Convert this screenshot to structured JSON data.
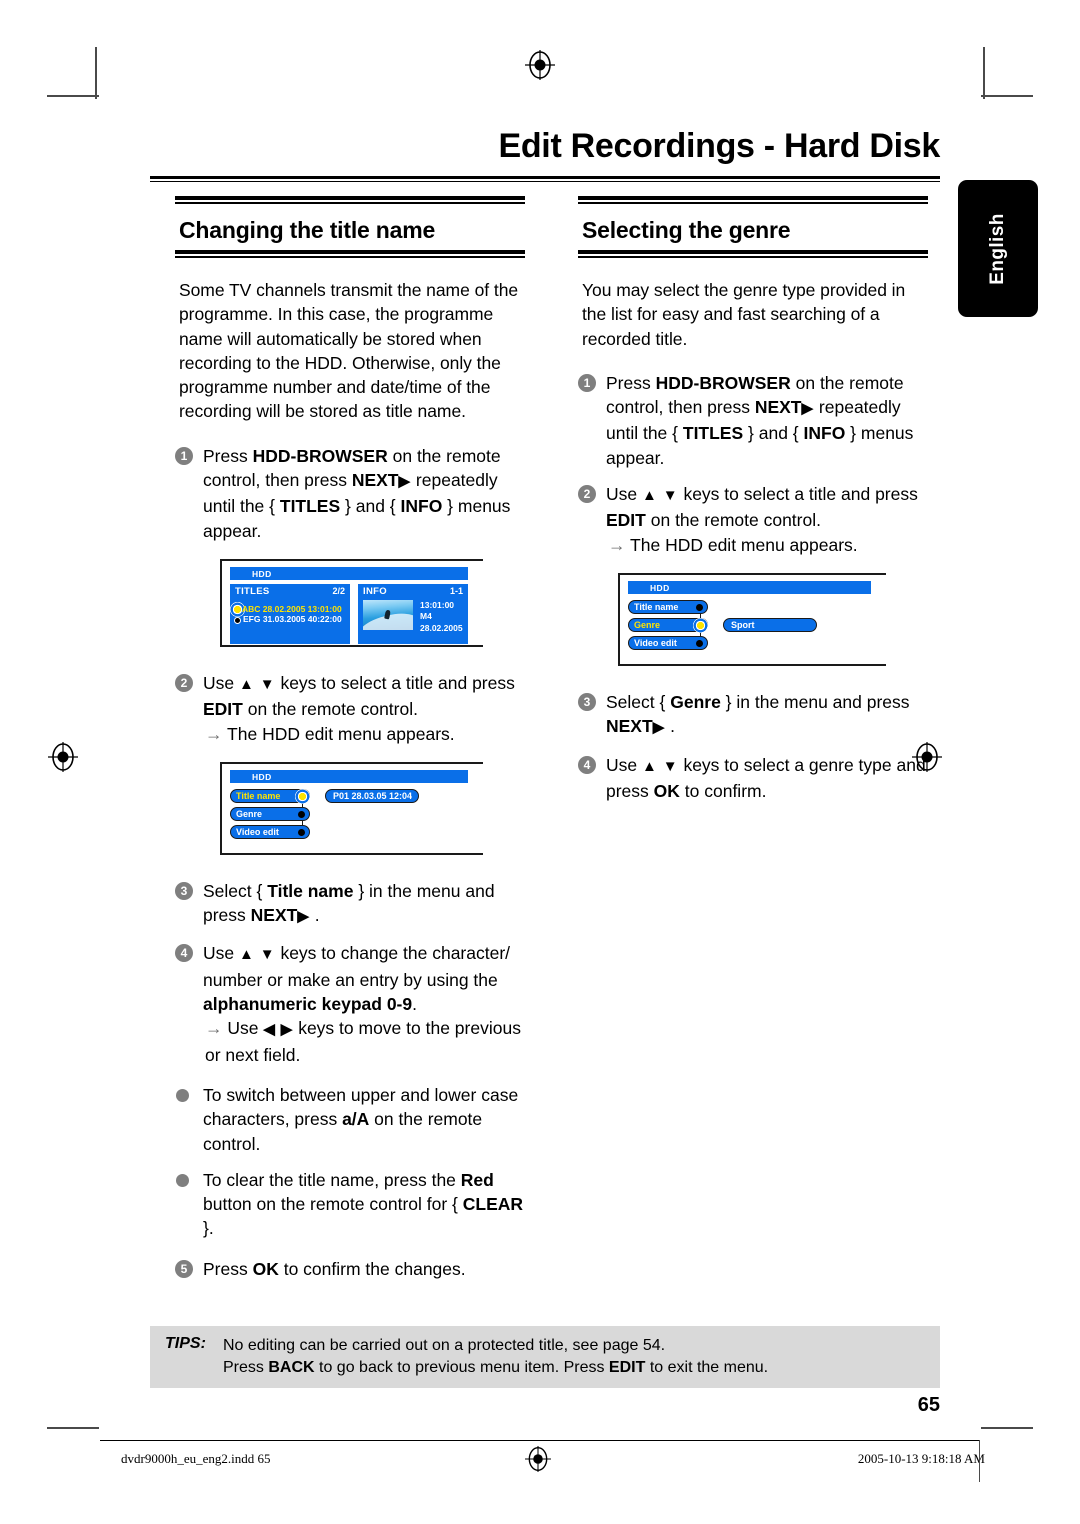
{
  "header": {
    "title": "Edit Recordings - Hard Disk",
    "language_tab": "English"
  },
  "left_column": {
    "heading": "Changing the title name",
    "intro": "Some TV channels transmit the name of the programme. In this case, the programme name will automatically be stored when recording to the HDD. Otherwise, only the programme number and date/time of the recording will be stored as title name.",
    "step1": {
      "num": "1",
      "part1": "Press ",
      "b1": "HDD-BROWSER",
      "part2": " on the remote control, then press ",
      "b2": "NEXT",
      "tri": "▶",
      "part3": " repeatedly until the { ",
      "b3": "TITLES",
      "part4": " } and { ",
      "b4": "INFO",
      "part5": " } menus appear."
    },
    "screenshot1": {
      "hdd_label": "HDD",
      "titles_panel": {
        "title": "TITLES",
        "count": "2/2",
        "rows": [
          {
            "text": "ABC 28.02.2005   13:01:00",
            "selected": true
          },
          {
            "text": "EFG 31.03.2005   40:22:00",
            "selected": false
          }
        ]
      },
      "info_panel": {
        "title": "INFO",
        "count": "1-1",
        "lines": [
          "13:01:00",
          "M4",
          "28.02.2005"
        ]
      }
    },
    "step2": {
      "num": "2",
      "part1": "Use ",
      "up": "▲",
      "down": "▼",
      "part2": " keys to select a title and press ",
      "b1": "EDIT",
      "part3": " on the remote control.",
      "sub_arrow": "→",
      "sub": " The HDD edit menu appears."
    },
    "screenshot2": {
      "hdd_label": "HDD",
      "items": [
        {
          "label": "Title name",
          "selected": true
        },
        {
          "label": "Genre",
          "selected": false
        },
        {
          "label": "Video edit",
          "selected": false
        }
      ],
      "value": "P01 28.03.05 12:04"
    },
    "step3": {
      "num": "3",
      "part1": "Select { ",
      "b1": "Title name",
      "part2": " } in the menu and press ",
      "b2": "NEXT",
      "tri": "▶",
      "part3": " ."
    },
    "step4": {
      "num": "4",
      "part1": "Use ",
      "up": "▲",
      "down": "▼",
      "part2": " keys to change the character/ number or make an entry by using the ",
      "b1": "alphanumeric keypad 0-9",
      "part3": ".",
      "sub_arrow": "→",
      "sub1": " Use ",
      "left": "◀",
      "right": "▶",
      "sub2": " keys to move to the previous or next field."
    },
    "bullet1": {
      "part1": "To switch between upper and lower case characters, press ",
      "b1": "a/A",
      "part2": " on the remote control."
    },
    "bullet2": {
      "part1": "To clear the title name, press the ",
      "b1": "Red",
      "part2": " button on the remote control for { ",
      "b2": "CLEAR",
      "part3": " }."
    },
    "step5": {
      "num": "5",
      "part1": "Press ",
      "b1": "OK",
      "part2": " to confirm the changes."
    }
  },
  "right_column": {
    "heading": "Selecting the genre",
    "intro": "You may select the genre type provided in the list for easy and fast searching of a recorded title.",
    "step1": {
      "num": "1",
      "part1": "Press ",
      "b1": "HDD-BROWSER",
      "part2": " on the remote control, then press ",
      "b2": "NEXT",
      "tri": "▶",
      "part3": " repeatedly until the { ",
      "b3": "TITLES",
      "part4": " } and { ",
      "b4": "INFO",
      "part5": " } menus appear."
    },
    "step2": {
      "num": "2",
      "part1": "Use ",
      "up": "▲",
      "down": "▼",
      "part2": " keys to select a title and press ",
      "b1": "EDIT",
      "part3": " on the remote control.",
      "sub_arrow": "→",
      "sub": " The HDD edit menu appears."
    },
    "screenshot1": {
      "hdd_label": "HDD",
      "items": [
        {
          "label": "Title name",
          "selected": false
        },
        {
          "label": "Genre",
          "selected": true
        },
        {
          "label": "Video edit",
          "selected": false
        }
      ],
      "value": "Sport"
    },
    "step3": {
      "num": "3",
      "part1": "Select { ",
      "b1": "Genre",
      "part2": " } in the menu and press ",
      "b2": "NEXT",
      "tri": "▶",
      "part3": " ."
    },
    "step4": {
      "num": "4",
      "part1": "Use ",
      "up": "▲",
      "down": "▼",
      "part2": " keys to select a genre type and press ",
      "b1": "OK",
      "part3": " to confirm."
    }
  },
  "tips": {
    "label": "TIPS:",
    "line1": "No editing can be carried out on a protected title, see page 54.",
    "line2_p1": "Press ",
    "line2_b1": "BACK",
    "line2_p2": " to go back to previous menu item. Press ",
    "line2_b2": "EDIT",
    "line2_p3": " to exit the menu."
  },
  "page_number": "65",
  "footer": {
    "file": "dvdr9000h_eu_eng2.indd   65",
    "timestamp": "2005-10-13   9:18:18 AM"
  },
  "colors": {
    "tv_blue": "#0a6fe8",
    "tv_yellow": "#ffe400",
    "tips_bg": "#d9d9d9",
    "step_num_bg": "#7f7f7f"
  }
}
